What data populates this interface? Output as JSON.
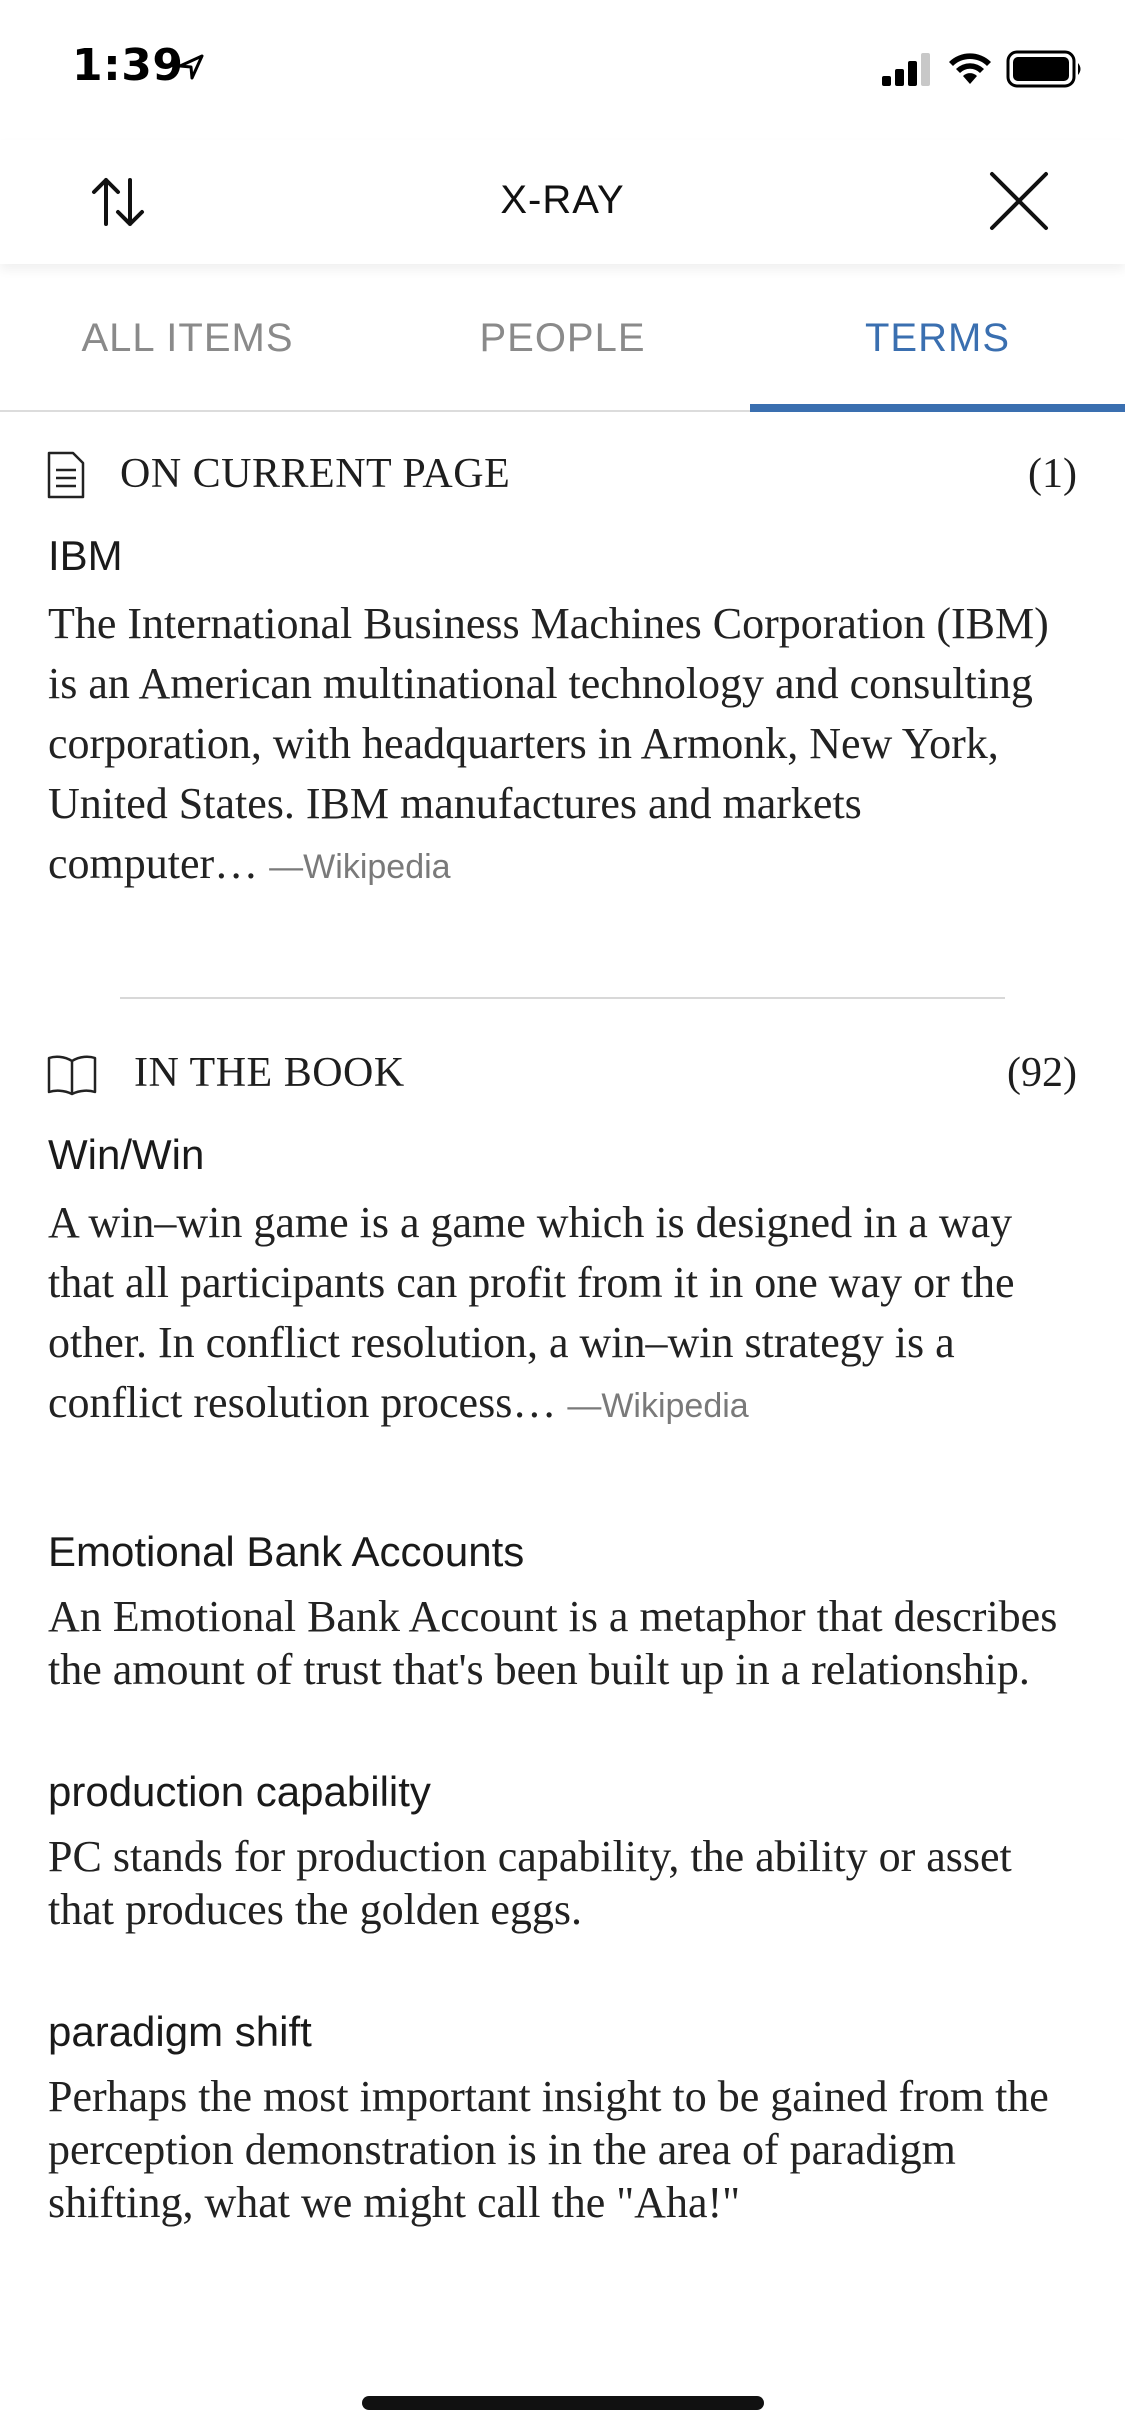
{
  "status": {
    "time": "1:39"
  },
  "header": {
    "title": "X-RAY"
  },
  "tabs": [
    {
      "label": "ALL ITEMS"
    },
    {
      "label": "PEOPLE"
    },
    {
      "label": "TERMS"
    }
  ],
  "sections": {
    "current_page": {
      "label": "ON CURRENT PAGE",
      "count": "(1)",
      "items": [
        {
          "name": "IBM",
          "description": "The International Business Machines Corporation (IBM) is an American multinational technology and consulting corporation, with headquarters in Armonk, New York, United States. IBM manufactures and markets computer…",
          "source": "—Wikipedia"
        }
      ]
    },
    "in_book": {
      "label": "IN THE BOOK",
      "count": "(92)",
      "items": [
        {
          "name": "Win/Win",
          "description": "A win–win game is a game which is designed in a way that all participants can profit from it in one way or the other. In conflict resolution, a win–win strategy is a conflict resolution process…",
          "source": "—Wikipedia"
        },
        {
          "name": "Emotional Bank Accounts",
          "description": "An Emotional Bank Account is a metaphor that describes the amount of trust that's been built up in a relationship."
        },
        {
          "name": "production capability",
          "description": "PC stands for production capability, the ability or asset that produces the golden eggs."
        },
        {
          "name": "paradigm shift",
          "description": "Perhaps the most important insight to be gained from the perception demonstration is in the area of paradigm shifting, what we might call the \"Aha!\""
        }
      ]
    }
  },
  "colors": {
    "accent": "#3a6fb0"
  }
}
